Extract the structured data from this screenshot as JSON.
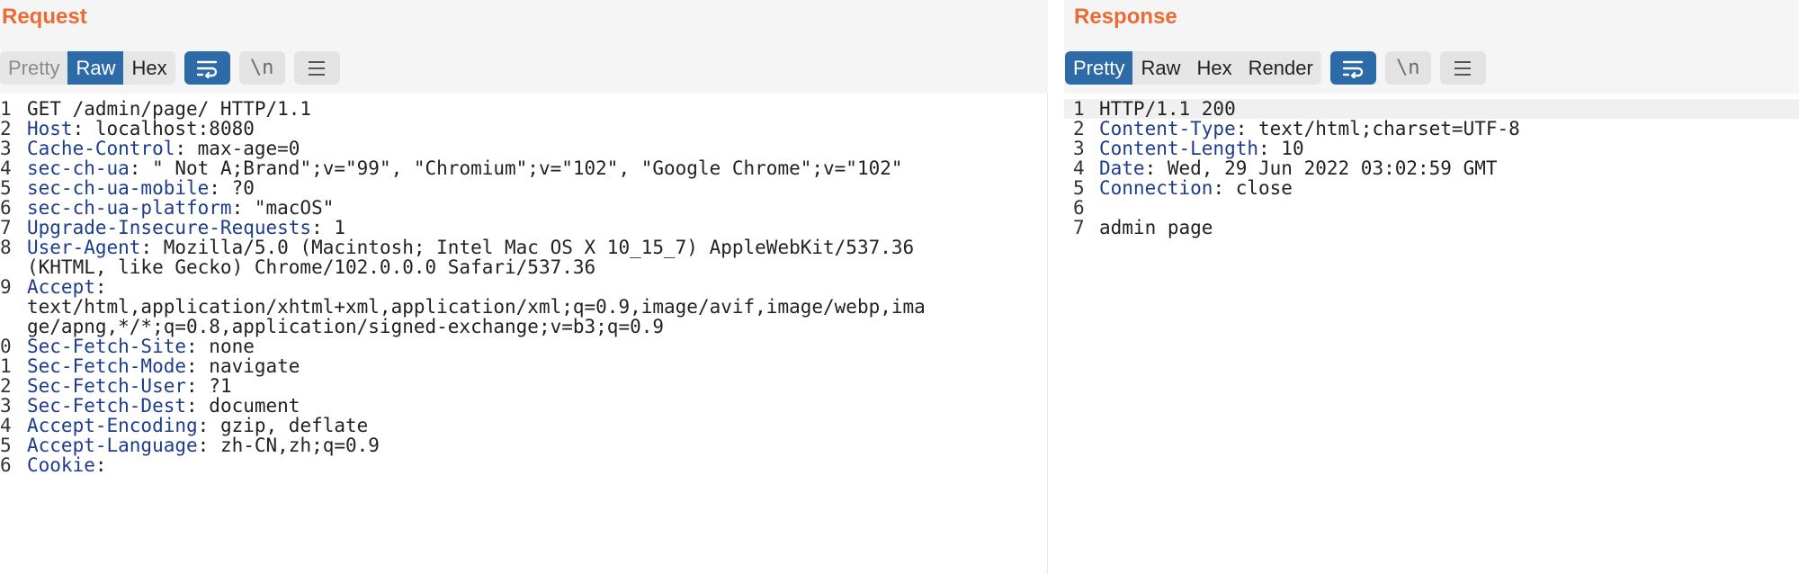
{
  "request": {
    "title": "Request",
    "tabs": [
      {
        "label": "Pretty",
        "state": "disabled"
      },
      {
        "label": "Raw",
        "state": "active"
      },
      {
        "label": "Hex",
        "state": "normal"
      }
    ],
    "newline_label": "\\n",
    "lines": [
      {
        "n": "1",
        "name": "",
        "value": "GET /admin/page/ HTTP/1.1"
      },
      {
        "n": "2",
        "name": "Host",
        "value": ": localhost:8080"
      },
      {
        "n": "3",
        "name": "Cache-Control",
        "value": ": max-age=0"
      },
      {
        "n": "4",
        "name": "sec-ch-ua",
        "value": ": \" Not A;Brand\";v=\"99\", \"Chromium\";v=\"102\", \"Google Chrome\";v=\"102\""
      },
      {
        "n": "5",
        "name": "sec-ch-ua-mobile",
        "value": ": ?0"
      },
      {
        "n": "6",
        "name": "sec-ch-ua-platform",
        "value": ": \"macOS\""
      },
      {
        "n": "7",
        "name": "Upgrade-Insecure-Requests",
        "value": ": 1"
      },
      {
        "n": "8",
        "name": "User-Agent",
        "value": ": Mozilla/5.0 (Macintosh; Intel Mac OS X 10_15_7) AppleWebKit/537.36"
      },
      {
        "n": "",
        "name": "",
        "value": "(KHTML, like Gecko) Chrome/102.0.0.0 Safari/537.36"
      },
      {
        "n": "9",
        "name": "Accept",
        "value": ":"
      },
      {
        "n": "",
        "name": "",
        "value": "text/html,application/xhtml+xml,application/xml;q=0.9,image/avif,image/webp,ima"
      },
      {
        "n": "",
        "name": "",
        "value": "ge/apng,*/*;q=0.8,application/signed-exchange;v=b3;q=0.9"
      },
      {
        "n": "0",
        "name": "Sec-Fetch-Site",
        "value": ": none"
      },
      {
        "n": "1",
        "name": "Sec-Fetch-Mode",
        "value": ": navigate"
      },
      {
        "n": "2",
        "name": "Sec-Fetch-User",
        "value": ": ?1"
      },
      {
        "n": "3",
        "name": "Sec-Fetch-Dest",
        "value": ": document"
      },
      {
        "n": "4",
        "name": "Accept-Encoding",
        "value": ": gzip, deflate"
      },
      {
        "n": "5",
        "name": "Accept-Language",
        "value": ": zh-CN,zh;q=0.9"
      },
      {
        "n": "6",
        "name": "Cookie",
        "value": ":"
      }
    ]
  },
  "response": {
    "title": "Response",
    "tabs": [
      {
        "label": "Pretty",
        "state": "active"
      },
      {
        "label": "Raw",
        "state": "normal"
      },
      {
        "label": "Hex",
        "state": "normal"
      },
      {
        "label": "Render",
        "state": "normal"
      }
    ],
    "newline_label": "\\n",
    "lines": [
      {
        "n": "1",
        "name": "",
        "value": "HTTP/1.1 200",
        "highlight": true
      },
      {
        "n": "2",
        "name": "Content-Type",
        "value": ": text/html;charset=UTF-8"
      },
      {
        "n": "3",
        "name": "Content-Length",
        "value": ": 10"
      },
      {
        "n": "4",
        "name": "Date",
        "value": ": Wed, 29 Jun 2022 03:02:59 GMT"
      },
      {
        "n": "5",
        "name": "Connection",
        "value": ": close"
      },
      {
        "n": "6",
        "name": "",
        "value": ""
      },
      {
        "n": "7",
        "name": "",
        "value": "admin page"
      }
    ]
  },
  "colors": {
    "title": "#ec6a33",
    "active_tab": "#2d6aa8",
    "header_name": "#1c3c8c"
  },
  "icons": {
    "wrap": "wrap-lines-icon",
    "newline": "show-newlines-icon",
    "menu": "hamburger-menu-icon"
  }
}
